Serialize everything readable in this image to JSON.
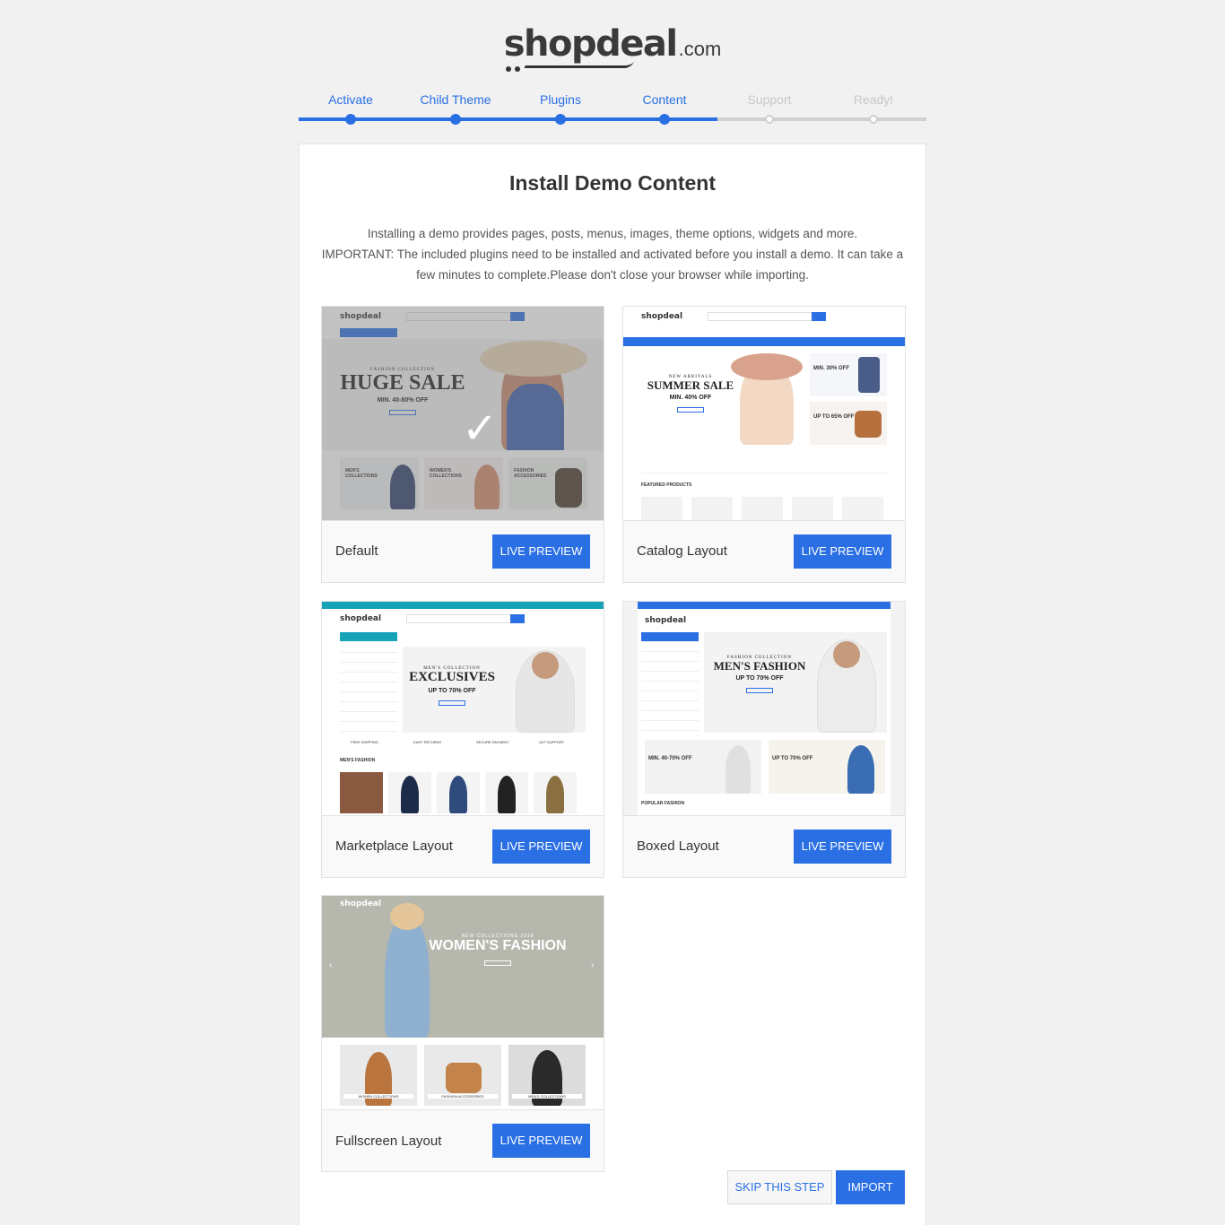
{
  "brand": {
    "name": "shopdeal",
    "tld": ".com"
  },
  "steps": [
    {
      "label": "Activate",
      "state": "done"
    },
    {
      "label": "Child Theme",
      "state": "done"
    },
    {
      "label": "Plugins",
      "state": "done"
    },
    {
      "label": "Content",
      "state": "done"
    },
    {
      "label": "Support",
      "state": "todo"
    },
    {
      "label": "Ready!",
      "state": "todo"
    }
  ],
  "content": {
    "title": "Install Demo Content",
    "description_line1": "Installing a demo provides pages, posts, menus, images, theme options, widgets and more.",
    "description_line2": "IMPORTANT: The included plugins need to be installed and activated before you install a demo. It can take a few minutes to complete.Please don't close your browser while importing."
  },
  "demos": [
    {
      "name": "Default",
      "button": "LIVE PREVIEW",
      "selected": true,
      "preview": {
        "logo": "shopdeal",
        "kicker": "FASHION COLLECTION",
        "headline": "HUGE SALE",
        "sub": "MIN. 40-80% OFF",
        "tiles": [
          "MEN'S COLLECTIONS",
          "WOMEN'S COLLECTIONS",
          "FASHION ACCESSORIES"
        ]
      }
    },
    {
      "name": "Catalog Layout",
      "button": "LIVE PREVIEW",
      "selected": false,
      "preview": {
        "logo": "shopdeal",
        "kicker": "NEW ARRIVALS",
        "headline": "SUMMER SALE",
        "sub": "MIN. 40% OFF",
        "side1": "MIN. 30% OFF",
        "side2": "UP TO 65% OFF",
        "section": "FEATURED PRODUCTS"
      }
    },
    {
      "name": "Marketplace Layout",
      "button": "LIVE PREVIEW",
      "selected": false,
      "preview": {
        "logo": "shopdeal",
        "kicker": "MEN'S COLLECTION",
        "headline": "EXCLUSIVES",
        "sub": "UP TO 70% OFF",
        "section": "MEN'S FASHION",
        "features": [
          "FREE SHIPPING",
          "EASY RETURNS",
          "SECURE PAYMENT",
          "24/7 SUPPORT"
        ]
      }
    },
    {
      "name": "Boxed Layout",
      "button": "LIVE PREVIEW",
      "selected": false,
      "preview": {
        "logo": "shopdeal",
        "kicker": "FASHION COLLECTION",
        "headline": "MEN'S FASHION",
        "sub": "UP TO 70% OFF",
        "banner1": "MIN. 40-70% OFF",
        "banner2": "UP TO 70% OFF",
        "section": "POPULAR FASHION"
      }
    },
    {
      "name": "Fullscreen Layout",
      "button": "LIVE PREVIEW",
      "selected": false,
      "preview": {
        "logo": "shopdeal",
        "kicker": "NEW COLLECTIONS 2018",
        "headline": "WOMEN'S FASHION",
        "tiles": [
          "WOMEN COLLECTIONS",
          "FASHION ACCESSORIES",
          "MEN'S COLLECTIONS"
        ]
      }
    }
  ],
  "actions": {
    "skip": "SKIP THIS STEP",
    "import": "IMPORT"
  },
  "colors": {
    "accent": "#2a6fe4",
    "inactive": "#cfcfcf"
  }
}
